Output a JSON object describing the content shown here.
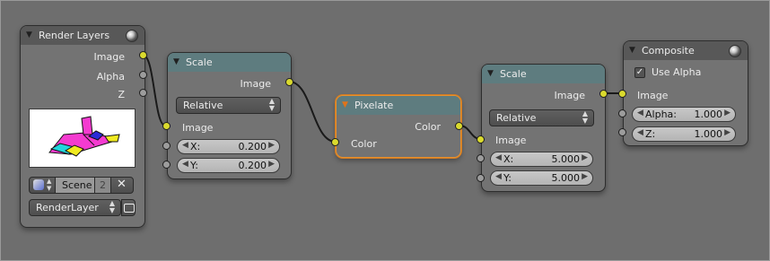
{
  "render_layers": {
    "title": "Render Layers",
    "outputs": [
      "Image",
      "Alpha",
      "Z"
    ],
    "scene_label": "Scene",
    "scene_users": "2",
    "layer_label": "RenderLayer"
  },
  "scale1": {
    "title": "Scale",
    "output": "Image",
    "mode": "Relative",
    "input": "Image",
    "x_label": "X:",
    "x_value": "0.200",
    "y_label": "Y:",
    "y_value": "0.200"
  },
  "pixelate": {
    "title": "Pixelate",
    "output": "Color",
    "input": "Color"
  },
  "scale2": {
    "title": "Scale",
    "output": "Image",
    "mode": "Relative",
    "input": "Image",
    "x_label": "X:",
    "x_value": "5.000",
    "y_label": "Y:",
    "y_value": "5.000"
  },
  "composite": {
    "title": "Composite",
    "use_alpha_label": "Use Alpha",
    "use_alpha": true,
    "check_mark": "✓",
    "input": "Image",
    "alpha_label": "Alpha:",
    "alpha_value": "1.000",
    "z_label": "Z:",
    "z_value": "1.000"
  },
  "colors": {
    "canvas": "#6e6e6e",
    "input_header": "#585858",
    "filter_header": "#5e7c7f",
    "output_header": "#585858",
    "selected_outline": "#e8902c",
    "image_socket": "#dada2e",
    "value_socket": "#9c9c9c"
  },
  "icons": {
    "collapse": "triangle-down-icon",
    "render": "sphere-icon",
    "scene": "scene-icon",
    "unlink": "close-icon",
    "camera": "render-camera-icon"
  }
}
